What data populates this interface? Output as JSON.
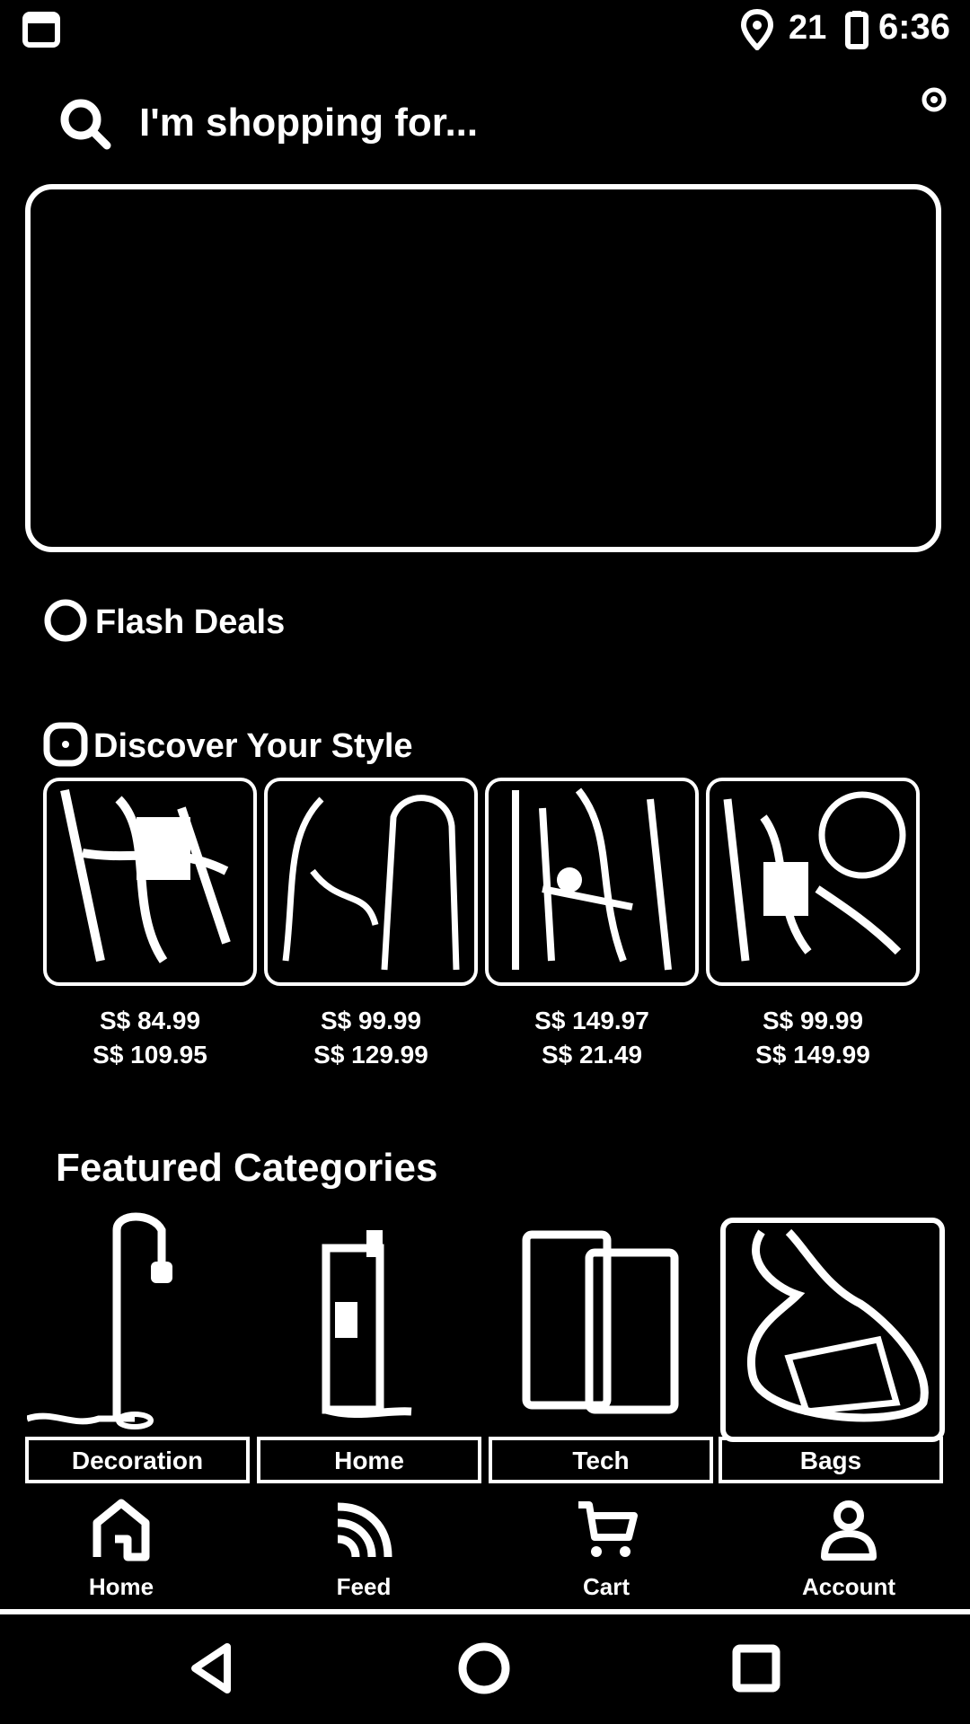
{
  "status_bar": {
    "time": "6:36",
    "battery_level": "21"
  },
  "search": {
    "placeholder": "I'm shopping for..."
  },
  "sections": {
    "flash_deals": {
      "title": "Flash Deals"
    },
    "discover": {
      "title": "Discover Your Style",
      "items": [
        {
          "price": "S$ 84.99",
          "old_price": "S$ 109.95"
        },
        {
          "price": "S$ 99.99",
          "old_price": "S$ 129.99"
        },
        {
          "price": "S$ 149.97",
          "old_price": "S$ 21.49"
        },
        {
          "price": "S$ 99.99",
          "old_price": "S$ 149.99"
        }
      ]
    },
    "featured": {
      "title": "Featured Categories",
      "items": [
        {
          "label": "Decoration"
        },
        {
          "label": "Home"
        },
        {
          "label": "Tech"
        },
        {
          "label": "Bags"
        }
      ]
    }
  },
  "bottom_nav": {
    "items": [
      {
        "label": "Home",
        "icon": "home-icon"
      },
      {
        "label": "Feed",
        "icon": "feed-icon"
      },
      {
        "label": "Cart",
        "icon": "cart-icon"
      },
      {
        "label": "Account",
        "icon": "account-icon"
      }
    ]
  },
  "system_nav": {
    "back": "back-icon",
    "home": "home-circle-icon",
    "recents": "recents-icon"
  }
}
